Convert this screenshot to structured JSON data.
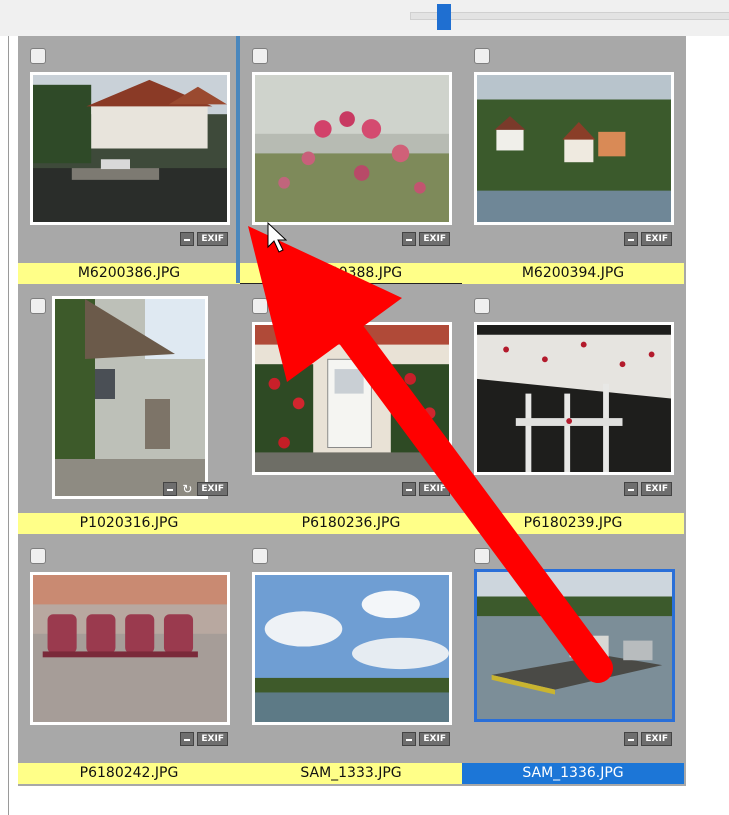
{
  "slider": {
    "thumb_position": 0.08
  },
  "thumbnails": [
    {
      "filename": "M6200386.JPG",
      "selected": false,
      "rotated": false
    },
    {
      "filename": "M6200388.JPG",
      "selected": false,
      "rotated": false
    },
    {
      "filename": "M6200394.JPG",
      "selected": false,
      "rotated": false
    },
    {
      "filename": "P1020316.JPG",
      "selected": false,
      "rotated": true
    },
    {
      "filename": "P6180236.JPG",
      "selected": false,
      "rotated": false
    },
    {
      "filename": "P6180239.JPG",
      "selected": false,
      "rotated": false
    },
    {
      "filename": "P6180242.JPG",
      "selected": false,
      "rotated": false
    },
    {
      "filename": "SAM_1333.JPG",
      "selected": false,
      "rotated": false
    },
    {
      "filename": "SAM_1336.JPG",
      "selected": true,
      "rotated": false
    }
  ],
  "badge": {
    "exif": "EXIF",
    "rotate_symbol": "↻"
  },
  "colors": {
    "label_bg": "#ffff88",
    "selected_label_bg": "#1c76d7",
    "grid_bg": "#a8a8a8",
    "arrow": "#ff0000"
  }
}
